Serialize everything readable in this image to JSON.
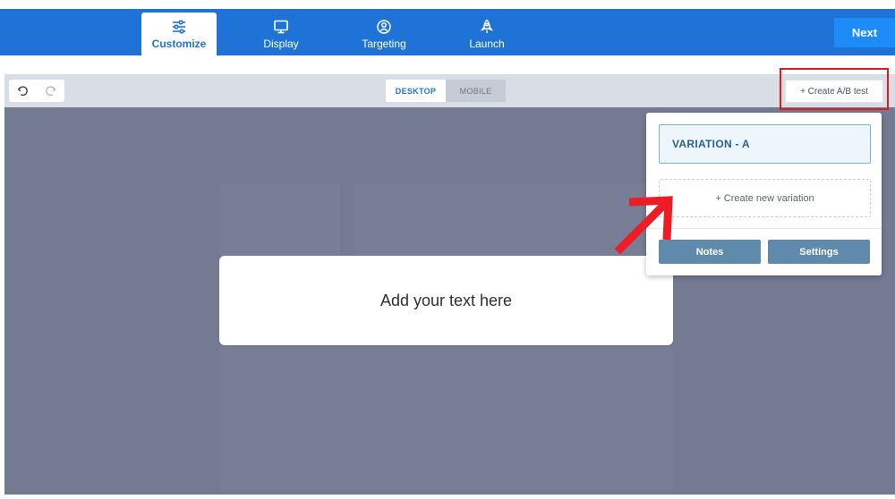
{
  "nav": {
    "tabs": [
      {
        "label": "Customize",
        "icon": "sliders-icon",
        "active": true
      },
      {
        "label": "Display",
        "icon": "monitor-icon",
        "active": false
      },
      {
        "label": "Targeting",
        "icon": "target-user-icon",
        "active": false
      },
      {
        "label": "Launch",
        "icon": "rocket-icon",
        "active": false
      }
    ],
    "next_label": "Next"
  },
  "toolbar": {
    "device_desktop": "DESKTOP",
    "device_mobile": "MOBILE",
    "ab_test_label": "+ Create A/B test"
  },
  "canvas": {
    "text_placeholder": "Add your text here"
  },
  "variations": {
    "current": "VARIATION - A",
    "create_new": "+ Create new variation",
    "notes_label": "Notes",
    "settings_label": "Settings"
  },
  "colors": {
    "brand_blue": "#1f73d6",
    "next_blue": "#1d8cf8",
    "canvas_gray": "#737a92",
    "highlight_red": "#e11b22",
    "panel_button": "#5f8aab"
  }
}
